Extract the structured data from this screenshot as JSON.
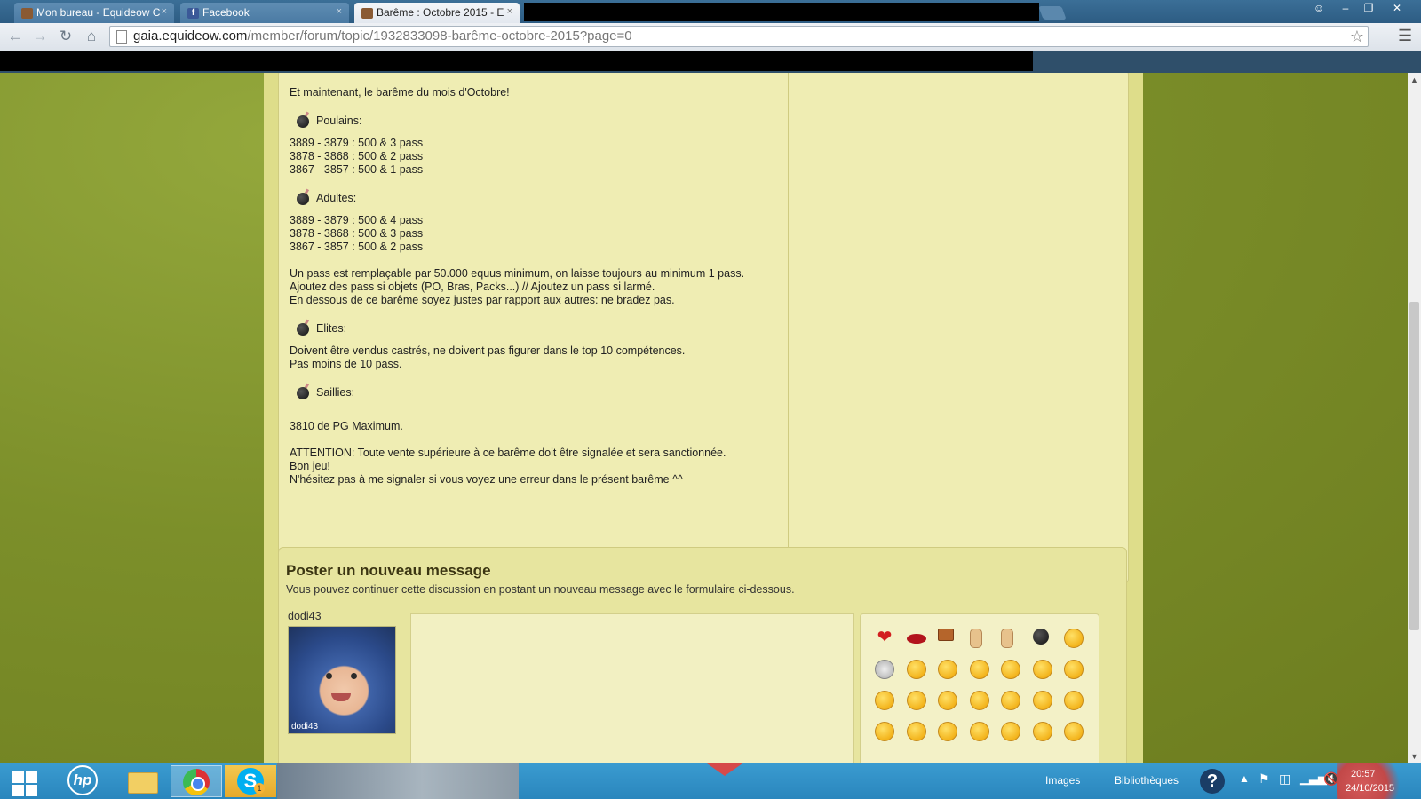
{
  "browser": {
    "tabs": [
      {
        "title": "Mon bureau - Equideow C",
        "active": false
      },
      {
        "title": "Facebook",
        "active": false
      },
      {
        "title": "Barême : Octobre 2015 - E",
        "active": true
      }
    ],
    "close_glyph": "×",
    "url_host": "gaia.equideow.com",
    "url_path": "/member/forum/topic/1932833098-barême-octobre-2015?page=0",
    "icons": {
      "back": "back-arrow-icon",
      "forward": "forward-arrow-icon",
      "reload": "reload-icon",
      "home": "home-icon",
      "bookmark": "star-icon",
      "menu": "hamburger-menu-icon"
    }
  },
  "post": {
    "intro": "Et maintenant, le barême du mois d'Octobre!",
    "sections": {
      "poulains": {
        "title": "Poulains:",
        "lines": [
          "3889 - 3879 : 500 & 3 pass",
          "3878 - 3868 : 500 & 2 pass",
          "3867 - 3857 : 500 & 1 pass"
        ]
      },
      "adultes": {
        "title": "Adultes:",
        "lines": [
          "3889 - 3879 : 500 & 4 pass",
          "3878 - 3868 : 500 & 3 pass",
          "3867 - 3857 : 500 & 2 pass"
        ]
      },
      "notes": [
        "Un pass est remplaçable par 50.000 equus minimum, on laisse toujours au minimum 1 pass.",
        "Ajoutez des pass si objets (PO, Bras, Packs...) // Ajoutez un pass si larmé.",
        "En dessous de ce barême soyez justes par rapport aux autres: ne bradez pas."
      ],
      "elites": {
        "title": "Elites:",
        "lines": [
          "Doivent être vendus castrés, ne doivent pas figurer dans le top 10 compétences.",
          "Pas moins de 10 pass."
        ]
      },
      "saillies": {
        "title": "Saillies:",
        "lines": [
          "3810 de PG Maximum."
        ]
      }
    },
    "closing": [
      "ATTENTION: Toute vente supérieure à ce barême doit être signalée et sera sanctionnée.",
      "Bon jeu!",
      "N'hésitez pas à me signaler si vous voyez une erreur dans le présent barême ^^"
    ]
  },
  "reply": {
    "title": "Poster un nouveau message",
    "description": "Vous pouvez continuer cette discussion en postant un nouveau message avec le formulaire ci-dessous.",
    "username": "dodi43",
    "avatar_caption": "dodi43",
    "message_value": ""
  },
  "emoji_icons": [
    "heart-icon",
    "lips-icon",
    "lol-sign-icon",
    "thumbs-up-icon",
    "thumbs-down-icon",
    "bomb-icon",
    "smiley-icon",
    "skull-icon",
    "grin-icon",
    "sad-icon",
    "wink-icon",
    "laugh-icon",
    "happy-icon",
    "tongue-icon",
    "nerd-icon",
    "angry-icon",
    "love-eyes-icon",
    "sunglasses-icon",
    "surprised-icon",
    "worried-icon",
    "mad-icon",
    "shocked-icon",
    "confused-icon",
    "smirk-icon",
    "thinking-icon",
    "cry-laugh-icon",
    "big-laugh-icon",
    "sick-icon"
  ],
  "taskbar": {
    "images_label": "Images",
    "libraries_label": "Bibliothèques",
    "time": "20:57",
    "date": "24/10/2015",
    "skype_badge": "1"
  },
  "colors": {
    "page_bg": "#7a8a26",
    "content_bg": "#dedd8a",
    "post_bg": "#efedb3",
    "taskbar": "#2a86bd"
  }
}
